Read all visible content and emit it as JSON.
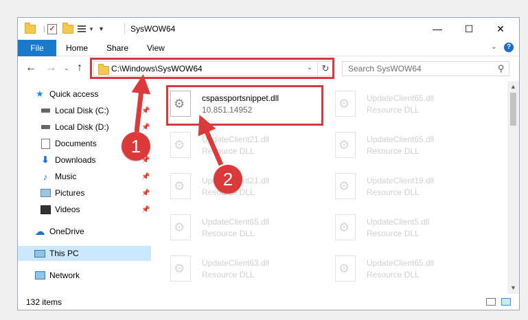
{
  "window": {
    "title": "SysWOW64"
  },
  "ribbon": {
    "tabs": [
      "File",
      "Home",
      "Share",
      "View"
    ]
  },
  "nav": {
    "address": "C:\\Windows\\SysWOW64",
    "search_placeholder": "Search SysWOW64"
  },
  "sidebar": {
    "items": [
      {
        "label": "Quick access",
        "icon": "star-icon",
        "pinned": false
      },
      {
        "label": "Local Disk (C:)",
        "icon": "drive-icon",
        "pinned": true
      },
      {
        "label": "Local Disk (D:)",
        "icon": "drive-icon",
        "pinned": true
      },
      {
        "label": "Documents",
        "icon": "documents-icon",
        "pinned": true
      },
      {
        "label": "Downloads",
        "icon": "download-icon",
        "pinned": true
      },
      {
        "label": "Music",
        "icon": "music-icon",
        "pinned": true
      },
      {
        "label": "Pictures",
        "icon": "pictures-icon",
        "pinned": true
      },
      {
        "label": "Videos",
        "icon": "videos-icon",
        "pinned": true
      },
      {
        "label": "OneDrive",
        "icon": "cloud-icon",
        "pinned": false
      },
      {
        "label": "This PC",
        "icon": "computer-icon",
        "pinned": false,
        "selected": true
      },
      {
        "label": "Network",
        "icon": "network-icon",
        "pinned": false
      }
    ]
  },
  "files": [
    {
      "name": "cspassportsnippet.dll",
      "sub": "10.851.14952",
      "highlight": true
    },
    {
      "name": "UpdateClient65.dll",
      "sub": "Resource DLL"
    },
    {
      "name": "UpdateClient21.dll",
      "sub": "Resource DLL"
    },
    {
      "name": "UpdateClient65.dll",
      "sub": "Resource DLL"
    },
    {
      "name": "UpdateClient21.dll",
      "sub": "Resource DLL"
    },
    {
      "name": "UpdateClient19.dll",
      "sub": "Resource DLL"
    },
    {
      "name": "UpdateClient65.dll",
      "sub": "Resource DLL"
    },
    {
      "name": "UpdateClient5.dll",
      "sub": "Resource DLL"
    },
    {
      "name": "UpdateClient63.dll",
      "sub": "Resource DLL"
    },
    {
      "name": "UpdateClient65.dll",
      "sub": "Resource DLL"
    }
  ],
  "status": {
    "item_count": "132 items"
  },
  "annotations": {
    "step1": "1",
    "step2": "2",
    "color": "#dc3a3a"
  }
}
